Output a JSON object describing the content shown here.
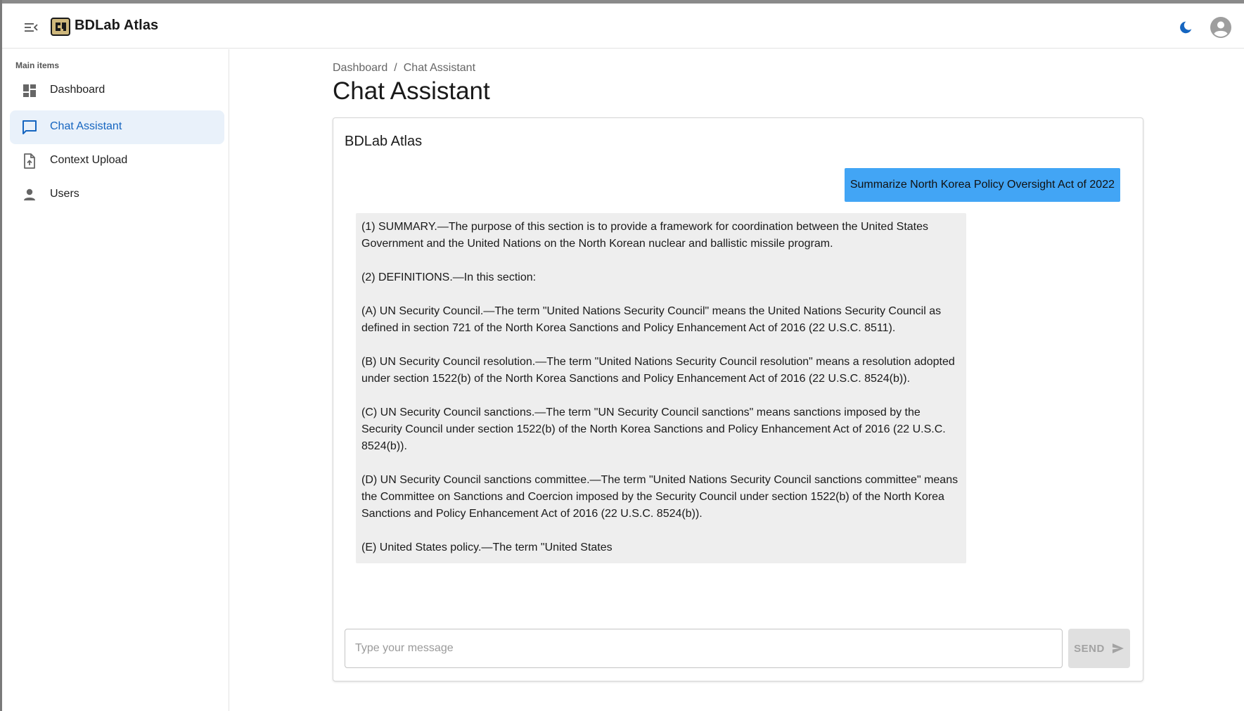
{
  "app": {
    "title": "BDLab Atlas",
    "accent_color": "#1565c0"
  },
  "header": {
    "menu_icon": "menu-collapse-icon",
    "logo_icon": "logo-icon",
    "theme_icon": "moon-icon",
    "account_icon": "account-circle-icon"
  },
  "sidebar": {
    "heading": "Main items",
    "items": [
      {
        "label": "Dashboard",
        "icon": "dashboard-icon",
        "active": false
      },
      {
        "label": "Chat Assistant",
        "icon": "chat-icon",
        "active": true
      },
      {
        "label": "Context Upload",
        "icon": "upload-file-icon",
        "active": false
      },
      {
        "label": "Users",
        "icon": "person-icon",
        "active": false
      }
    ]
  },
  "breadcrumb": {
    "items": [
      "Dashboard",
      "Chat Assistant"
    ],
    "separator": "/"
  },
  "page": {
    "title": "Chat Assistant"
  },
  "chat": {
    "title": "BDLab Atlas",
    "user_message": "Summarize North Korea Policy Oversight Act of 2022",
    "assistant_message": "(1) SUMMARY.—The purpose of this section is to provide a framework for coordination between the United States Government and the United Nations on the North Korean nuclear and ballistic missile program.\n\n(2) DEFINITIONS.—In this section:\n\n(A) UN Security Council.—The term \"United Nations Security Council\" means the United Nations Security Council as defined in section 721 of the North Korea Sanctions and Policy Enhancement Act of 2016 (22 U.S.C. 8511).\n\n(B) UN Security Council resolution.—The term \"United Nations Security Council resolution\" means a resolution adopted under section 1522(b) of the North Korea Sanctions and Policy Enhancement Act of 2016 (22 U.S.C. 8524(b)).\n\n(C) UN Security Council sanctions.—The term \"UN Security Council sanctions\" means sanctions imposed by the Security Council under section 1522(b) of the North Korea Sanctions and Policy Enhancement Act of 2016 (22 U.S.C. 8524(b)).\n\n(D) UN Security Council sanctions committee.—The term \"United Nations Security Council sanctions committee\" means the Committee on Sanctions and Coercion imposed by the Security Council under section 1522(b) of the North Korea Sanctions and Policy Enhancement Act of 2016 (22 U.S.C. 8524(b)).\n\n(E) United States policy.—The term \"United States",
    "user_bubble_color": "#42a5f5",
    "assistant_bubble_color": "#eeeeee",
    "input": {
      "value": "",
      "placeholder": "Type your message"
    },
    "send_label": "SEND",
    "send_icon": "send-icon"
  }
}
